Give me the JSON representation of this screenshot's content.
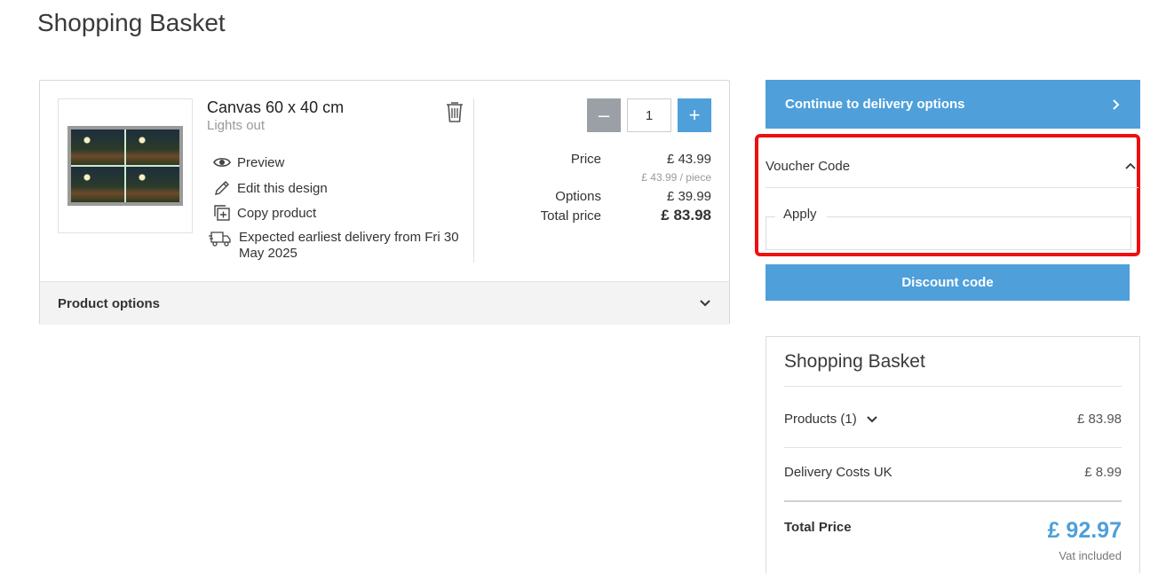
{
  "page": {
    "title": "Shopping Basket"
  },
  "product": {
    "title": "Canvas 60 x 40 cm",
    "subtitle": "Lights out",
    "actions": {
      "preview": "Preview",
      "edit": "Edit this design",
      "copy": "Copy product"
    },
    "delivery": "Expected earliest delivery from Fri 30 May 2025",
    "quantity": "1",
    "qty_minus": "–",
    "qty_plus": "+",
    "pricing": {
      "price_label": "Price",
      "price_value": "£ 43.99",
      "per_piece": "£ 43.99 / piece",
      "options_label": "Options",
      "options_value": "£ 39.99",
      "total_label": "Total price",
      "total_value": "£ 83.98"
    },
    "options_toggle": "Product options"
  },
  "checkout": {
    "continue_label": "Continue to delivery options",
    "voucher_title": "Voucher Code",
    "voucher_field_label": "Apply",
    "discount_label": "Discount code"
  },
  "summary": {
    "title": "Shopping Basket",
    "products_label": "Products (1)",
    "products_value": "£ 83.98",
    "delivery_label": "Delivery Costs UK",
    "delivery_value": "£ 8.99",
    "total_label": "Total Price",
    "total_value": "£ 92.97",
    "vat_note": "Vat included"
  },
  "colors": {
    "accent": "#4e9fda",
    "highlight": "#ee0f0f",
    "disabled": "#9aa0a6"
  },
  "icons": [
    "trash-icon",
    "eye-icon",
    "pencil-icon",
    "copy-icon",
    "truck-icon",
    "chevron-down-icon",
    "chevron-right-icon",
    "chevron-up-icon"
  ]
}
